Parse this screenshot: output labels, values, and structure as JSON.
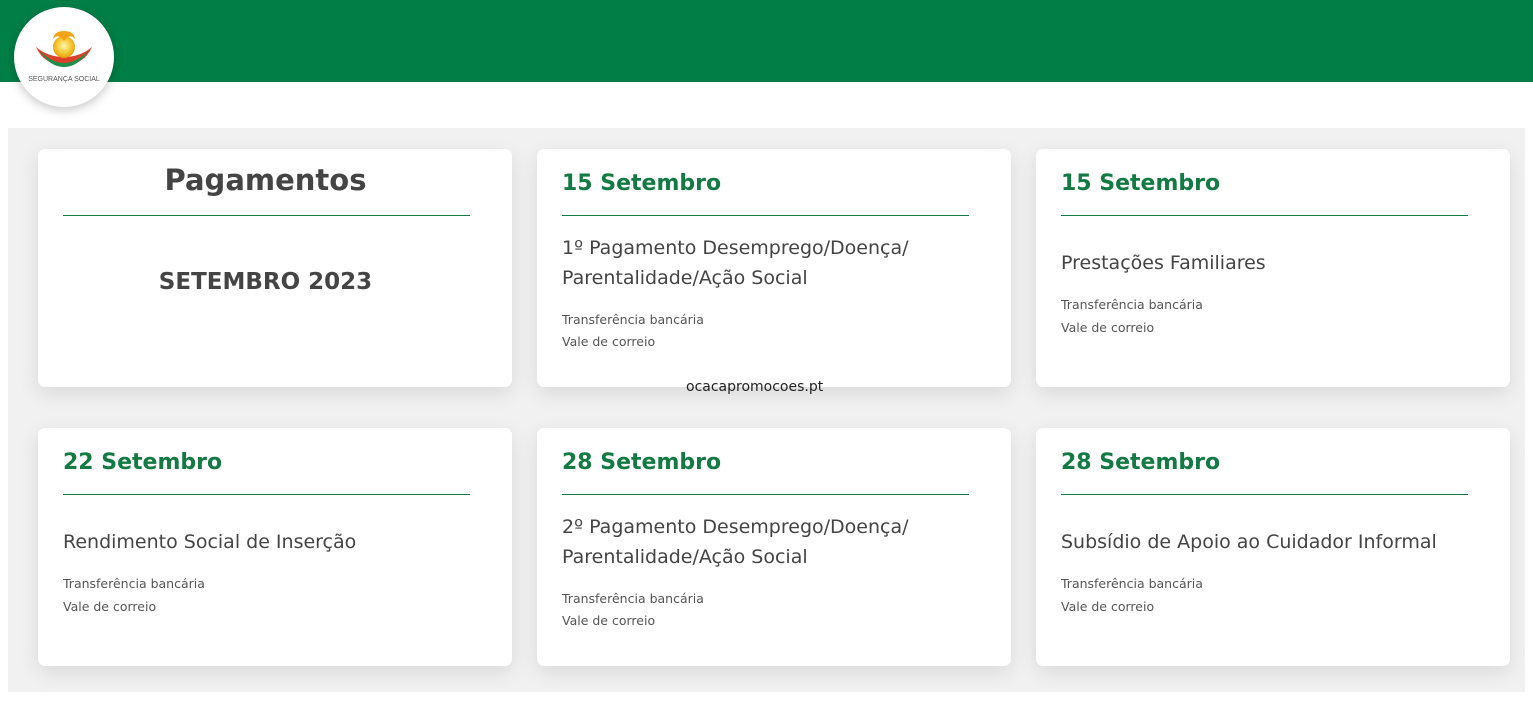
{
  "brand": {
    "logo_text": "SEGURANÇA SOCIAL",
    "header_color": "#007e45",
    "accent_color": "#137a44"
  },
  "intro": {
    "title": "Pagamentos",
    "subtitle": "SETEMBRO 2023"
  },
  "cards": [
    {
      "date": "15 Setembro",
      "title": "1º Pagamento Desemprego/Doença/ Parentalidade/Ação Social",
      "methods": [
        "Transferência bancária",
        "Vale de correio"
      ]
    },
    {
      "date": "15 Setembro",
      "title": "Prestações Familiares",
      "methods": [
        "Transferência bancária",
        "Vale de correio"
      ]
    },
    {
      "date": "22 Setembro",
      "title": "Rendimento Social de Inserção",
      "methods": [
        "Transferência bancária",
        "Vale de correio"
      ]
    },
    {
      "date": "28 Setembro",
      "title": "2º Pagamento Desemprego/Doença/ Parentalidade/Ação Social",
      "methods": [
        "Transferência bancária",
        "Vale de correio"
      ]
    },
    {
      "date": "28 Setembro",
      "title": "Subsídio de Apoio ao Cuidador Informal",
      "methods": [
        "Transferência bancária",
        "Vale de correio"
      ]
    }
  ],
  "watermark": "ocacapromocoes.pt"
}
